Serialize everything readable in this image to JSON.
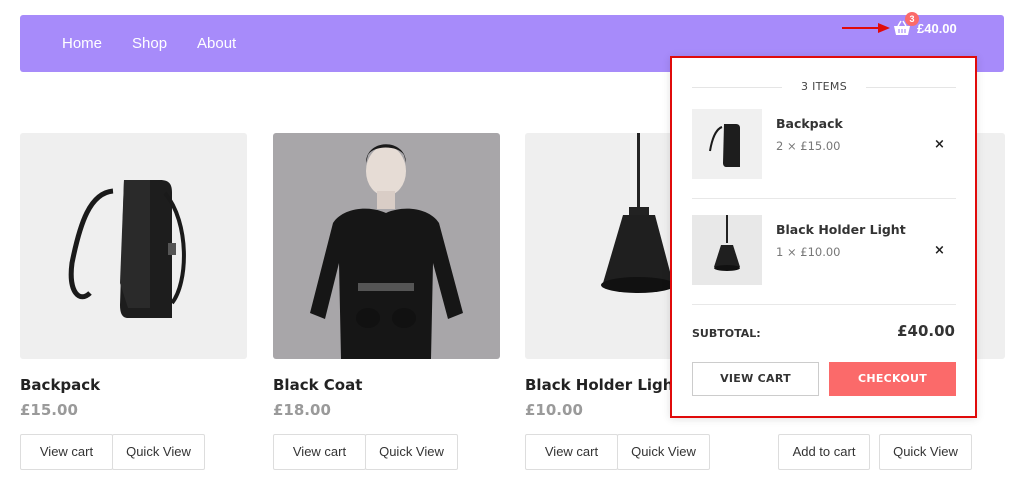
{
  "nav": {
    "links": [
      "Home",
      "Shop",
      "About"
    ],
    "cart": {
      "count": "3",
      "total": "£40.00"
    }
  },
  "products": [
    {
      "name": "Backpack",
      "price": "£15.00",
      "buttons": [
        "View cart",
        "Quick View"
      ]
    },
    {
      "name": "Black Coat",
      "price": "£18.00",
      "buttons": [
        "View cart",
        "Quick View"
      ]
    },
    {
      "name": "Black Holder Light",
      "price": "£10.00",
      "buttons": [
        "View cart",
        "Quick View"
      ]
    },
    {
      "name": "",
      "price": "",
      "buttons": [
        "Add to cart",
        "Quick View"
      ]
    }
  ],
  "cart_dropdown": {
    "items_count": "3 ITEMS",
    "items": [
      {
        "name": "Backpack",
        "qty": "2 × £15.00",
        "remove": "×"
      },
      {
        "name": "Black Holder Light",
        "qty": "1 × £10.00",
        "remove": "×"
      }
    ],
    "subtotal_label": "SUBTOTAL:",
    "subtotal_value": "£40.00",
    "view_cart": "VIEW CART",
    "checkout": "CHECKOUT"
  },
  "colors": {
    "nav": "#a78bfa",
    "badge": "#fb6a6a",
    "checkout": "#fb6a6a",
    "highlight": "#e00b0b"
  }
}
